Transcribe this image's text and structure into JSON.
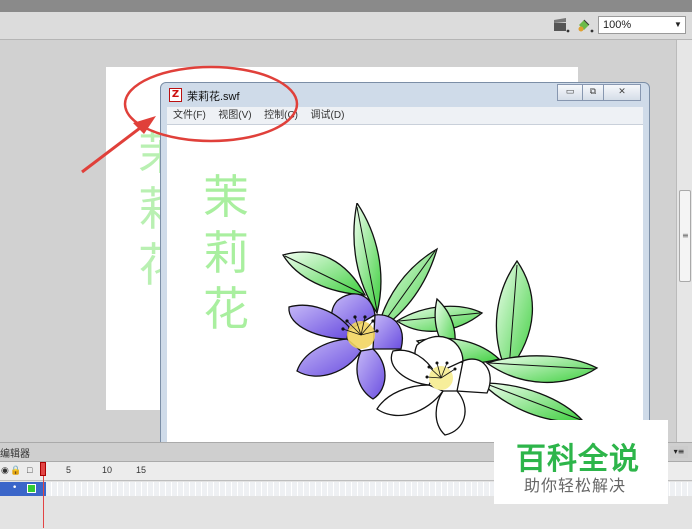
{
  "toolbar": {
    "zoom_value": "100%",
    "icons": [
      "clapper-icon",
      "paint-bucket-icon"
    ]
  },
  "stage": {
    "ghost_text": [
      "茉",
      "莉",
      "花"
    ]
  },
  "player_window": {
    "title": "茉莉花.swf",
    "menu": [
      "文件(F)",
      "视图(V)",
      "控制(C)",
      "调试(D)"
    ],
    "minimize": "▭",
    "restore": "⧉",
    "close": "✕",
    "content_text": [
      "茉",
      "莉",
      "花"
    ]
  },
  "timeline": {
    "panel_label": "编辑器",
    "ruler": [
      "1",
      "5",
      "10",
      "15"
    ]
  },
  "watermark": {
    "title": "百科全说",
    "subtitle": "助你轻松解决"
  },
  "colors": {
    "annotation": "#e0403a",
    "text_green": "#a9ef9f",
    "purple_petal": "#7f63e6",
    "leaf_green": "#3fcf3f",
    "watermark_green": "#2db54a"
  }
}
